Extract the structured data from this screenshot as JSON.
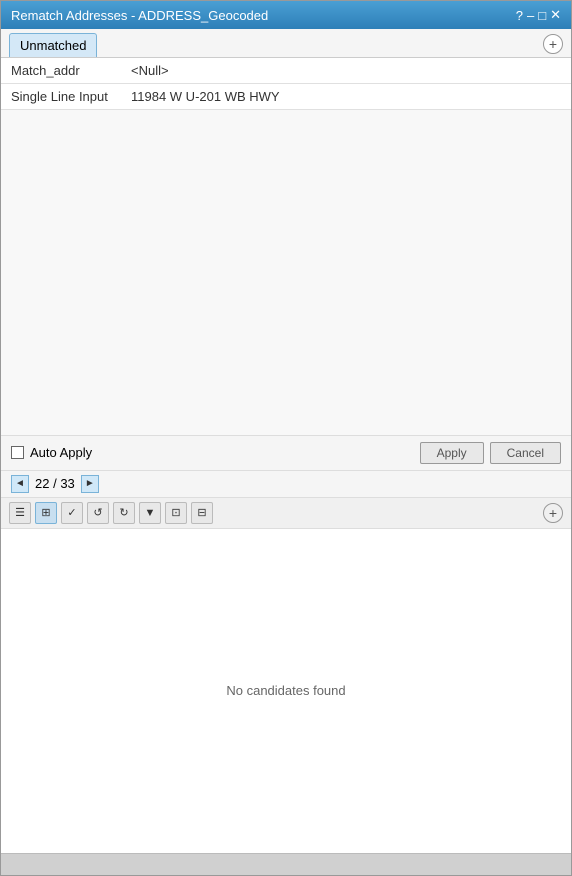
{
  "titleBar": {
    "title": "Rematch Addresses - ADDRESS_Geocoded",
    "controls": [
      "?",
      "-",
      "□",
      "✕"
    ]
  },
  "tab": {
    "label": "Unmatched",
    "addButton": "+"
  },
  "fields": [
    {
      "label": "Match_addr",
      "value": "<Null>"
    },
    {
      "label": "Single Line Input",
      "value": "11984 W U-201 WB HWY"
    }
  ],
  "autoApply": {
    "label": "Auto Apply",
    "checked": false
  },
  "buttons": {
    "apply": "Apply",
    "cancel": "Cancel"
  },
  "navigation": {
    "current": "22",
    "total": "33",
    "separator": " / "
  },
  "toolbar": {
    "icons": [
      "☰",
      "⊞",
      "✓",
      "↺",
      "↻",
      "▼",
      "⊡",
      "⊟"
    ],
    "addButton": "+"
  },
  "candidates": {
    "emptyMessage": "No candidates found"
  },
  "colors": {
    "titleBarStart": "#4a9fd4",
    "titleBarEnd": "#2e7fb8",
    "tabBackground": "#d4e8f7",
    "accent": "#2e7fb8"
  }
}
